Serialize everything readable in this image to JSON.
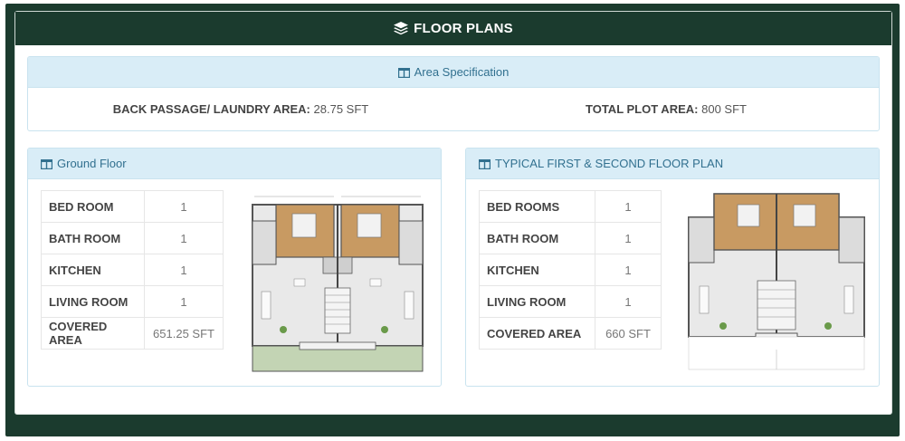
{
  "header": {
    "title": "FLOOR PLANS",
    "icon": "layers-icon"
  },
  "area_spec": {
    "title": "Area Specification",
    "items": [
      {
        "label": "BACK PASSAGE/ LAUNDRY AREA:",
        "value": "28.75 SFT"
      },
      {
        "label": "TOTAL PLOT AREA:",
        "value": "800 SFT"
      }
    ]
  },
  "ground_floor": {
    "title": "Ground Floor",
    "rows": [
      {
        "label": "BED ROOM",
        "value": "1"
      },
      {
        "label": "BATH ROOM",
        "value": "1"
      },
      {
        "label": "KITCHEN",
        "value": "1"
      },
      {
        "label": "LIVING ROOM",
        "value": "1"
      },
      {
        "label": "COVERED AREA",
        "value": "651.25 SFT"
      }
    ]
  },
  "typical_floor": {
    "title": "TYPICAL FIRST & SECOND FLOOR PLAN",
    "rows": [
      {
        "label": "BED ROOMS",
        "value": "1"
      },
      {
        "label": "BATH ROOM",
        "value": "1"
      },
      {
        "label": "KITCHEN",
        "value": "1"
      },
      {
        "label": "LIVING ROOM",
        "value": "1"
      },
      {
        "label": "COVERED AREA",
        "value": "660 SFT"
      }
    ]
  },
  "colors": {
    "brand_dark_green": "#1b3b2e",
    "info_bg": "#d9edf7",
    "info_text": "#31708f"
  }
}
